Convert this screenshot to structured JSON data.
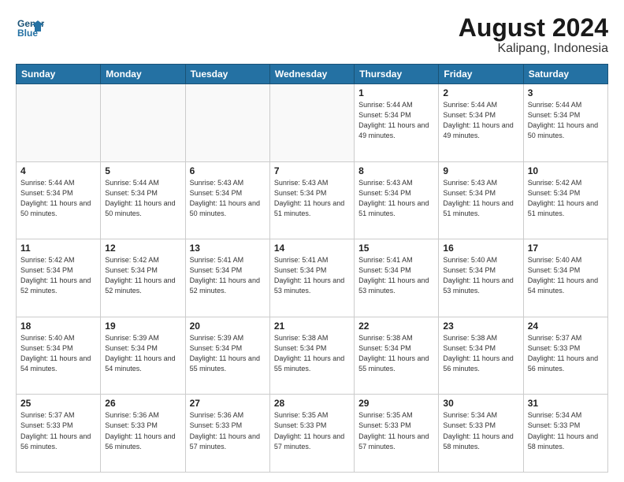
{
  "logo": {
    "line1": "General",
    "line2": "Blue"
  },
  "title": "August 2024",
  "subtitle": "Kalipang, Indonesia",
  "days_of_week": [
    "Sunday",
    "Monday",
    "Tuesday",
    "Wednesday",
    "Thursday",
    "Friday",
    "Saturday"
  ],
  "weeks": [
    [
      {
        "day": "",
        "info": ""
      },
      {
        "day": "",
        "info": ""
      },
      {
        "day": "",
        "info": ""
      },
      {
        "day": "",
        "info": ""
      },
      {
        "day": "1",
        "info": "Sunrise: 5:44 AM\nSunset: 5:34 PM\nDaylight: 11 hours\nand 49 minutes."
      },
      {
        "day": "2",
        "info": "Sunrise: 5:44 AM\nSunset: 5:34 PM\nDaylight: 11 hours\nand 49 minutes."
      },
      {
        "day": "3",
        "info": "Sunrise: 5:44 AM\nSunset: 5:34 PM\nDaylight: 11 hours\nand 50 minutes."
      }
    ],
    [
      {
        "day": "4",
        "info": "Sunrise: 5:44 AM\nSunset: 5:34 PM\nDaylight: 11 hours\nand 50 minutes."
      },
      {
        "day": "5",
        "info": "Sunrise: 5:44 AM\nSunset: 5:34 PM\nDaylight: 11 hours\nand 50 minutes."
      },
      {
        "day": "6",
        "info": "Sunrise: 5:43 AM\nSunset: 5:34 PM\nDaylight: 11 hours\nand 50 minutes."
      },
      {
        "day": "7",
        "info": "Sunrise: 5:43 AM\nSunset: 5:34 PM\nDaylight: 11 hours\nand 51 minutes."
      },
      {
        "day": "8",
        "info": "Sunrise: 5:43 AM\nSunset: 5:34 PM\nDaylight: 11 hours\nand 51 minutes."
      },
      {
        "day": "9",
        "info": "Sunrise: 5:43 AM\nSunset: 5:34 PM\nDaylight: 11 hours\nand 51 minutes."
      },
      {
        "day": "10",
        "info": "Sunrise: 5:42 AM\nSunset: 5:34 PM\nDaylight: 11 hours\nand 51 minutes."
      }
    ],
    [
      {
        "day": "11",
        "info": "Sunrise: 5:42 AM\nSunset: 5:34 PM\nDaylight: 11 hours\nand 52 minutes."
      },
      {
        "day": "12",
        "info": "Sunrise: 5:42 AM\nSunset: 5:34 PM\nDaylight: 11 hours\nand 52 minutes."
      },
      {
        "day": "13",
        "info": "Sunrise: 5:41 AM\nSunset: 5:34 PM\nDaylight: 11 hours\nand 52 minutes."
      },
      {
        "day": "14",
        "info": "Sunrise: 5:41 AM\nSunset: 5:34 PM\nDaylight: 11 hours\nand 53 minutes."
      },
      {
        "day": "15",
        "info": "Sunrise: 5:41 AM\nSunset: 5:34 PM\nDaylight: 11 hours\nand 53 minutes."
      },
      {
        "day": "16",
        "info": "Sunrise: 5:40 AM\nSunset: 5:34 PM\nDaylight: 11 hours\nand 53 minutes."
      },
      {
        "day": "17",
        "info": "Sunrise: 5:40 AM\nSunset: 5:34 PM\nDaylight: 11 hours\nand 54 minutes."
      }
    ],
    [
      {
        "day": "18",
        "info": "Sunrise: 5:40 AM\nSunset: 5:34 PM\nDaylight: 11 hours\nand 54 minutes."
      },
      {
        "day": "19",
        "info": "Sunrise: 5:39 AM\nSunset: 5:34 PM\nDaylight: 11 hours\nand 54 minutes."
      },
      {
        "day": "20",
        "info": "Sunrise: 5:39 AM\nSunset: 5:34 PM\nDaylight: 11 hours\nand 55 minutes."
      },
      {
        "day": "21",
        "info": "Sunrise: 5:38 AM\nSunset: 5:34 PM\nDaylight: 11 hours\nand 55 minutes."
      },
      {
        "day": "22",
        "info": "Sunrise: 5:38 AM\nSunset: 5:34 PM\nDaylight: 11 hours\nand 55 minutes."
      },
      {
        "day": "23",
        "info": "Sunrise: 5:38 AM\nSunset: 5:34 PM\nDaylight: 11 hours\nand 56 minutes."
      },
      {
        "day": "24",
        "info": "Sunrise: 5:37 AM\nSunset: 5:33 PM\nDaylight: 11 hours\nand 56 minutes."
      }
    ],
    [
      {
        "day": "25",
        "info": "Sunrise: 5:37 AM\nSunset: 5:33 PM\nDaylight: 11 hours\nand 56 minutes."
      },
      {
        "day": "26",
        "info": "Sunrise: 5:36 AM\nSunset: 5:33 PM\nDaylight: 11 hours\nand 56 minutes."
      },
      {
        "day": "27",
        "info": "Sunrise: 5:36 AM\nSunset: 5:33 PM\nDaylight: 11 hours\nand 57 minutes."
      },
      {
        "day": "28",
        "info": "Sunrise: 5:35 AM\nSunset: 5:33 PM\nDaylight: 11 hours\nand 57 minutes."
      },
      {
        "day": "29",
        "info": "Sunrise: 5:35 AM\nSunset: 5:33 PM\nDaylight: 11 hours\nand 57 minutes."
      },
      {
        "day": "30",
        "info": "Sunrise: 5:34 AM\nSunset: 5:33 PM\nDaylight: 11 hours\nand 58 minutes."
      },
      {
        "day": "31",
        "info": "Sunrise: 5:34 AM\nSunset: 5:33 PM\nDaylight: 11 hours\nand 58 minutes."
      }
    ]
  ]
}
